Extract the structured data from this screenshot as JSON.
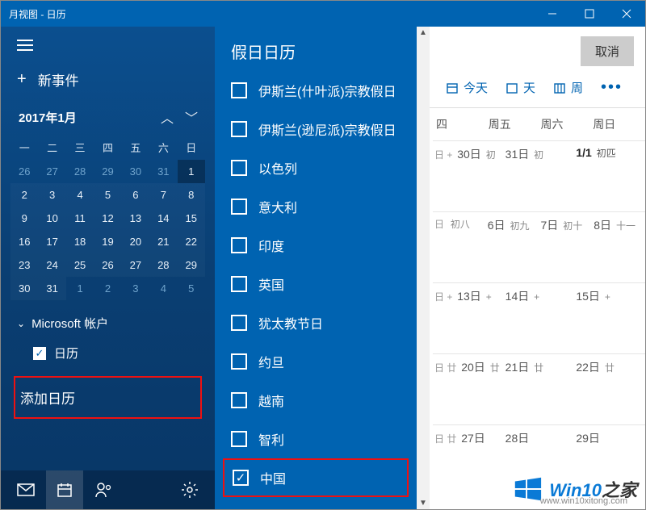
{
  "titlebar": {
    "title": "月视图 - 日历"
  },
  "sidebar": {
    "new_event": "新事件",
    "month_label": "2017年1月",
    "dow": [
      "一",
      "二",
      "三",
      "四",
      "五",
      "六",
      "日"
    ],
    "grid": [
      [
        {
          "n": "26",
          "dim": true
        },
        {
          "n": "27",
          "dim": true
        },
        {
          "n": "28",
          "dim": true
        },
        {
          "n": "29",
          "dim": true
        },
        {
          "n": "30",
          "dim": true
        },
        {
          "n": "31",
          "dim": true
        },
        {
          "n": "1",
          "today": true
        }
      ],
      [
        {
          "n": "2"
        },
        {
          "n": "3"
        },
        {
          "n": "4"
        },
        {
          "n": "5"
        },
        {
          "n": "6"
        },
        {
          "n": "7"
        },
        {
          "n": "8"
        }
      ],
      [
        {
          "n": "9"
        },
        {
          "n": "10"
        },
        {
          "n": "11"
        },
        {
          "n": "12"
        },
        {
          "n": "13"
        },
        {
          "n": "14"
        },
        {
          "n": "15"
        }
      ],
      [
        {
          "n": "16"
        },
        {
          "n": "17"
        },
        {
          "n": "18"
        },
        {
          "n": "19"
        },
        {
          "n": "20"
        },
        {
          "n": "21"
        },
        {
          "n": "22"
        }
      ],
      [
        {
          "n": "23"
        },
        {
          "n": "24"
        },
        {
          "n": "25"
        },
        {
          "n": "26"
        },
        {
          "n": "27"
        },
        {
          "n": "28"
        },
        {
          "n": "29"
        }
      ],
      [
        {
          "n": "30"
        },
        {
          "n": "31"
        },
        {
          "n": "1",
          "dim": true
        },
        {
          "n": "2",
          "dim": true
        },
        {
          "n": "3",
          "dim": true
        },
        {
          "n": "4",
          "dim": true
        },
        {
          "n": "5",
          "dim": true
        }
      ]
    ],
    "account_label": "Microsoft 帐户",
    "calendar_item": "日历",
    "add_calendar": "添加日历"
  },
  "holiday_panel": {
    "title": "假日日历",
    "items": [
      {
        "label": "伊斯兰(什叶派)宗教假日",
        "checked": false
      },
      {
        "label": "伊斯兰(逊尼派)宗教假日",
        "checked": false
      },
      {
        "label": "以色列",
        "checked": false
      },
      {
        "label": "意大利",
        "checked": false
      },
      {
        "label": "印度",
        "checked": false
      },
      {
        "label": "英国",
        "checked": false
      },
      {
        "label": "犹太教节日",
        "checked": false
      },
      {
        "label": "约旦",
        "checked": false
      },
      {
        "label": "越南",
        "checked": false
      },
      {
        "label": "智利",
        "checked": false
      },
      {
        "label": "中国",
        "checked": true,
        "highlight": true
      }
    ]
  },
  "main": {
    "cancel": "取消",
    "today": "今天",
    "day": "天",
    "week": "周",
    "day_headers": [
      "四",
      "周五",
      "周六",
      "周日"
    ],
    "weeks": [
      [
        {
          "pre": "日 +",
          "d": "30日",
          "lun": "初"
        },
        {
          "d": "31日",
          "lun": "初"
        },
        {
          "d": "1/1",
          "lun": "初匹",
          "bold": true
        }
      ],
      [
        {
          "pre": "日",
          "d": "",
          "lun": "初八"
        },
        {
          "d": "6日",
          "lun": "初九"
        },
        {
          "d": "7日",
          "lun": "初十"
        },
        {
          "d": "8日",
          "lun": "十一"
        }
      ],
      [
        {
          "pre": "日 +",
          "d": "13日",
          "lun": "+"
        },
        {
          "d": "14日",
          "lun": "+"
        },
        {
          "d": "15日",
          "lun": "+"
        }
      ],
      [
        {
          "pre": "日 廿",
          "d": "20日",
          "lun": "廿"
        },
        {
          "d": "21日",
          "lun": "廿"
        },
        {
          "d": "22日",
          "lun": "廿"
        }
      ],
      [
        {
          "pre": "日 廿",
          "d": "27日",
          "lun": ""
        },
        {
          "d": "28日",
          "lun": ""
        },
        {
          "d": "29日",
          "lun": ""
        }
      ]
    ]
  },
  "watermark": {
    "brand": "Win10",
    "suffix": "之家",
    "url": "www.win10xitong.com"
  }
}
